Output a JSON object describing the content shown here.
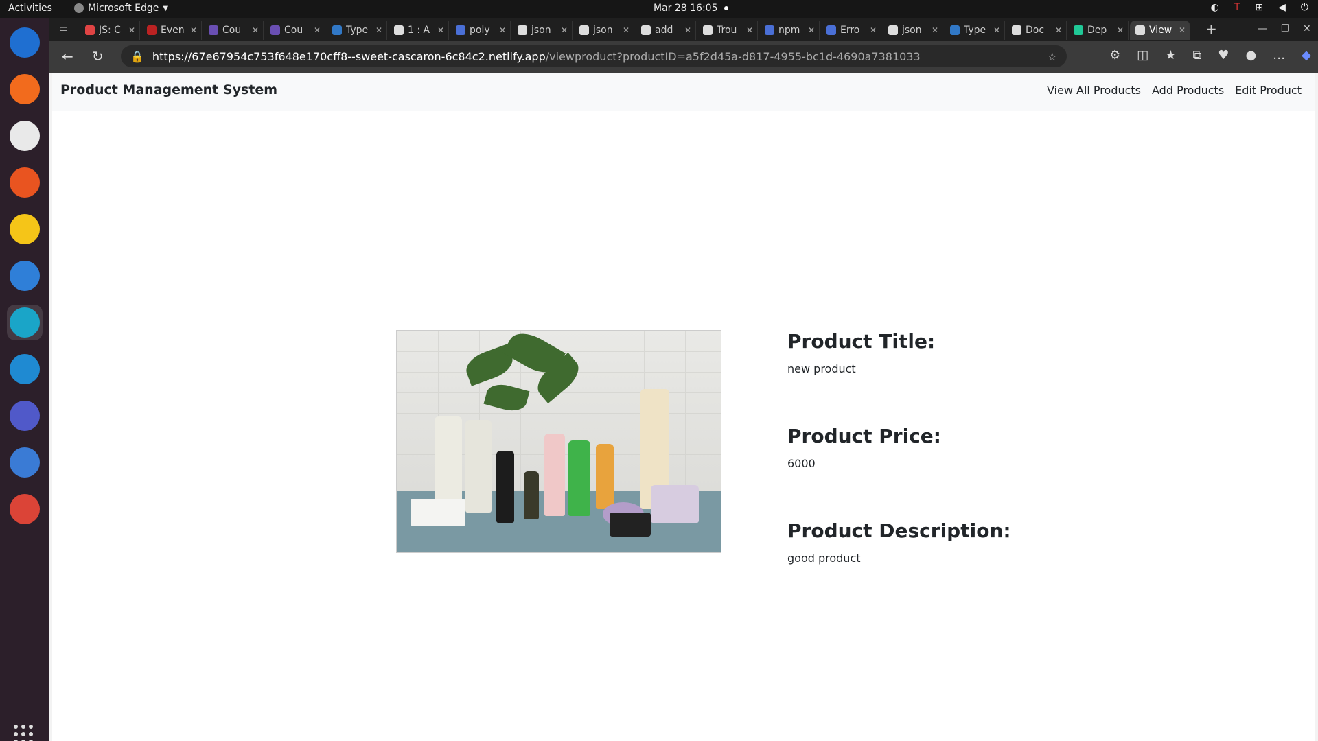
{
  "system": {
    "activities": "Activities",
    "app_name": "Microsoft Edge",
    "datetime": "Mar 28  16:05"
  },
  "tabs": [
    {
      "label": "JS: C",
      "color": "#e04444"
    },
    {
      "label": "Even",
      "color": "#b22"
    },
    {
      "label": "Cou",
      "color": "#6a4fb3"
    },
    {
      "label": "Cou",
      "color": "#6a4fb3"
    },
    {
      "label": "Type",
      "color": "#3178c6"
    },
    {
      "label": "1 : A",
      "color": "#ddd"
    },
    {
      "label": "poly",
      "color": "#4a6fd6"
    },
    {
      "label": "json",
      "color": "#ddd"
    },
    {
      "label": "json",
      "color": "#ddd"
    },
    {
      "label": "add",
      "color": "#ddd"
    },
    {
      "label": "Trou",
      "color": "#ddd"
    },
    {
      "label": "npm",
      "color": "#4a6fd6"
    },
    {
      "label": "Erro",
      "color": "#4a6fd6"
    },
    {
      "label": "json",
      "color": "#ddd"
    },
    {
      "label": "Type",
      "color": "#3178c6"
    },
    {
      "label": "Doc",
      "color": "#ddd"
    },
    {
      "label": "Dep",
      "color": "#20c997"
    },
    {
      "label": "View",
      "color": "#ddd"
    }
  ],
  "address_bar": {
    "host": "https://67e67954c753f648e170cff8--sweet-cascaron-6c84c2.netlify.app",
    "path": "/viewproduct?productID=a5f2d45a-d817-4955-bc1d-4690a7381033"
  },
  "site": {
    "brand": "Product Management System",
    "nav": {
      "view_all": "View All Products",
      "add": "Add Products",
      "edit": "Edit Product"
    }
  },
  "product": {
    "title_heading": "Product Title:",
    "title": "new product",
    "price_heading": "Product Price:",
    "price": "6000",
    "description_heading": "Product Description:",
    "description": "good product"
  },
  "dock": [
    {
      "name": "thunderbird-icon",
      "color": "#1f6fd1"
    },
    {
      "name": "firefox-icon",
      "color": "#f26b1d"
    },
    {
      "name": "files-icon",
      "color": "#e9e9e9"
    },
    {
      "name": "app-center-icon",
      "color": "#e95420"
    },
    {
      "name": "rhythmbox-icon",
      "color": "#f5c518"
    },
    {
      "name": "help-icon",
      "color": "#2f7fd8"
    },
    {
      "name": "edge-icon",
      "color": "#1aa5c8"
    },
    {
      "name": "vscode-icon",
      "color": "#1f8ad2"
    },
    {
      "name": "teams-icon",
      "color": "#5059c9"
    },
    {
      "name": "todo-icon",
      "color": "#3a7bd5"
    },
    {
      "name": "chrome-icon",
      "color": "#db4437"
    }
  ]
}
